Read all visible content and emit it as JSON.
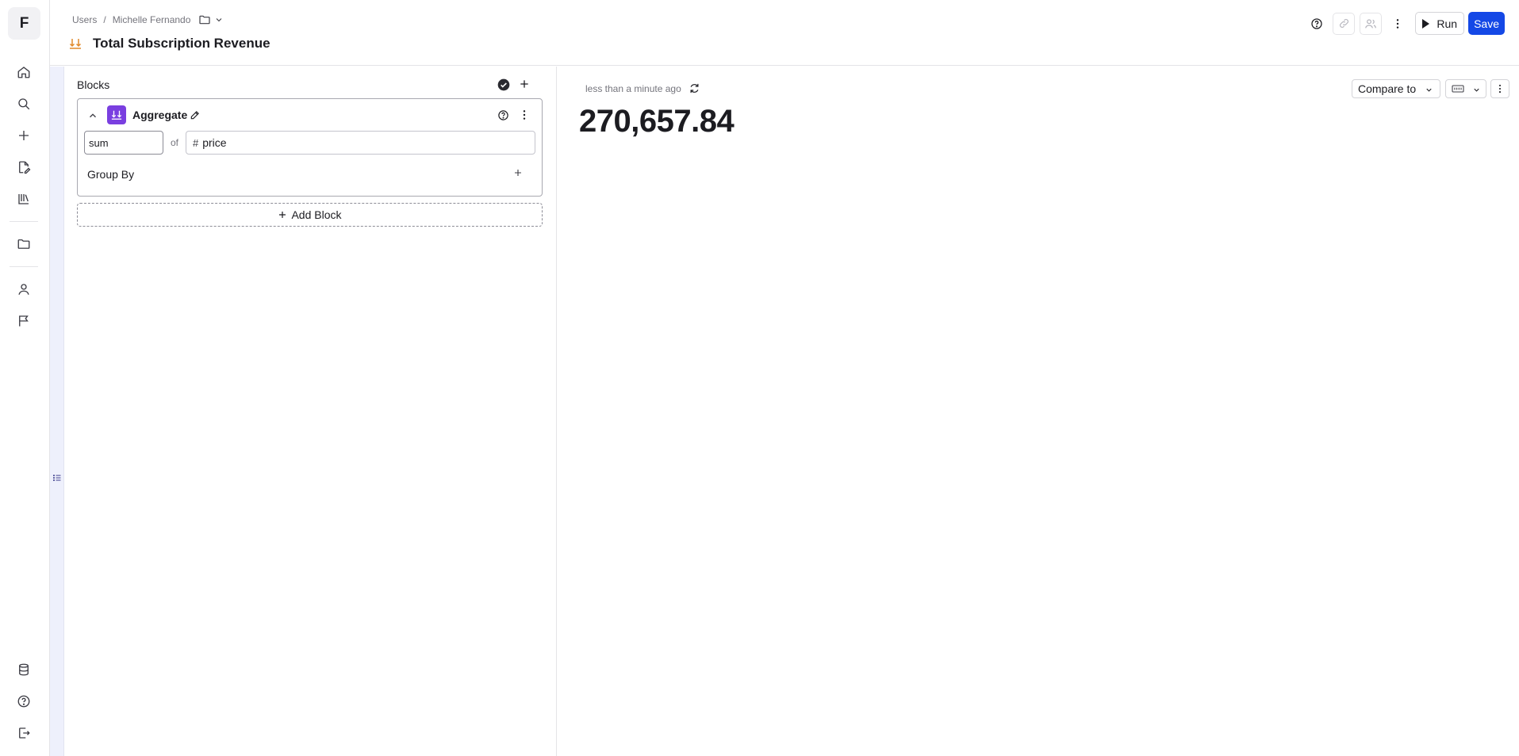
{
  "app": {
    "logo_letter": "F"
  },
  "sidebar": {
    "items": [
      {
        "name": "home",
        "icon": "home-icon"
      },
      {
        "name": "search",
        "icon": "search-icon"
      },
      {
        "name": "new",
        "icon": "plus-icon"
      },
      {
        "name": "new-document",
        "icon": "document-edit-icon"
      },
      {
        "name": "library",
        "icon": "library-icon"
      },
      {
        "name": "collections",
        "icon": "folder-icon"
      },
      {
        "name": "users",
        "icon": "user-icon"
      },
      {
        "name": "events",
        "icon": "flag-icon"
      }
    ],
    "bottom_items": [
      {
        "name": "database",
        "icon": "database-icon"
      },
      {
        "name": "help",
        "icon": "help-icon"
      },
      {
        "name": "logout",
        "icon": "logout-icon"
      }
    ]
  },
  "header": {
    "breadcrumb": [
      "Users",
      "Michelle Fernando"
    ],
    "breadcrumb_separator": "/",
    "title": "Total Subscription Revenue",
    "run_label": "Run",
    "save_label": "Save",
    "accent_color": "#1448e6"
  },
  "blocks": {
    "heading": "Blocks",
    "items": [
      {
        "type_label": "Aggregate",
        "type_color": "#7a3fe0",
        "aggregation": "sum",
        "of_label": "of",
        "column": "price",
        "column_type_icon": "#",
        "group_by_label": "Group By"
      }
    ],
    "add_block_label": "Add Block"
  },
  "result": {
    "updated_text": "less than a minute ago",
    "value": "270,657.84",
    "compare_label": "Compare to"
  }
}
